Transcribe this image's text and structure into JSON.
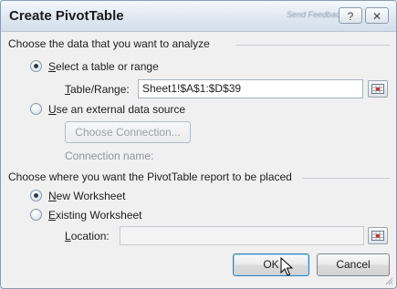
{
  "dialog": {
    "title": "Create PivotTable",
    "feedback_label": "Send Feedback",
    "help_label": "?",
    "close_label": "✕"
  },
  "data_section": {
    "heading": "Choose the data that you want to analyze",
    "select_range": {
      "prefix": "",
      "underline": "S",
      "rest": "elect a table or range",
      "selected": true
    },
    "table_range": {
      "underline": "T",
      "rest": "able/Range:",
      "value": "Sheet1!$A$1:$D$39"
    },
    "external": {
      "underline": "U",
      "rest": "se an external data source",
      "selected": false
    },
    "choose_connection_label": "Choose Connection...",
    "connection_name_label": "Connection name:"
  },
  "placement_section": {
    "heading": "Choose where you want the PivotTable report to be placed",
    "new_worksheet": {
      "underline": "N",
      "rest": "ew Worksheet",
      "selected": true
    },
    "existing_worksheet": {
      "underline": "E",
      "rest": "xisting Worksheet",
      "selected": false
    },
    "location": {
      "underline": "L",
      "rest": "ocation:",
      "value": ""
    }
  },
  "buttons": {
    "ok_label": "OK",
    "cancel_label": "Cancel"
  },
  "icons": {
    "range_picker": "range-picker-icon",
    "cursor": "mouse-pointer-icon",
    "help": "help-icon",
    "close": "close-icon"
  }
}
